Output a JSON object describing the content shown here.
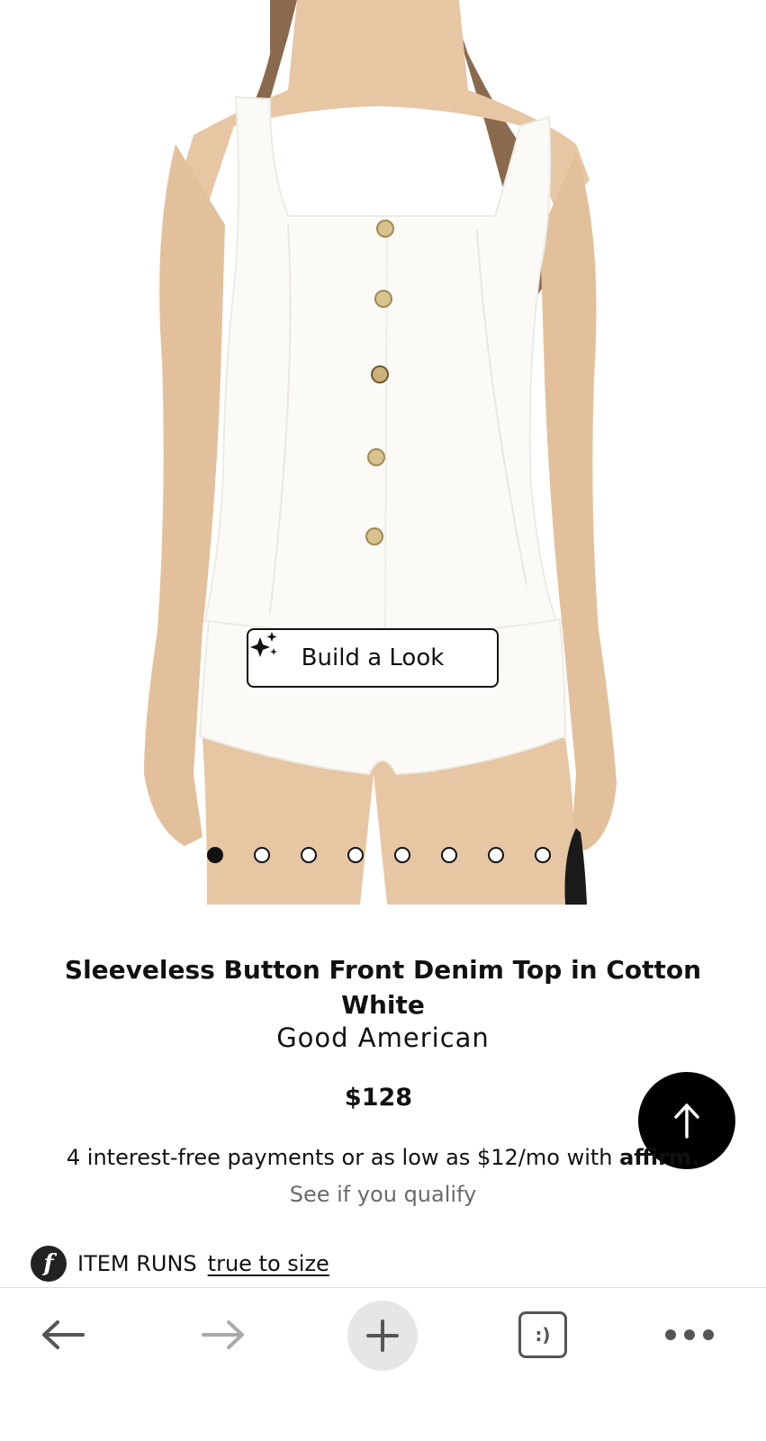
{
  "product": {
    "build_look_label": "Build a Look",
    "image_count": 8,
    "active_image_index": 0,
    "title": "Sleeveless Button Front Denim Top in Cotton White",
    "brand": "Good American",
    "price": "$128",
    "payments_text": "4 interest-free payments or as low as $12/mo with",
    "payments_provider": "affirm.",
    "qualify_link": "See if you qualify",
    "fit_label": "ITEM RUNS",
    "fit_value": "true to size",
    "fit_logo_letter": "f"
  },
  "toolbar": {
    "tabs_label": ":)"
  },
  "icons": {
    "scroll_top": "arrow-up-icon",
    "build_look": "sparkle-icon",
    "back": "arrow-left-icon",
    "forward": "arrow-right-icon",
    "new_tab": "plus-icon",
    "tabs": "tabs-icon",
    "more": "ellipsis-icon"
  },
  "colors": {
    "text": "#111111",
    "muted": "#6a6a6a",
    "accent": "#000000",
    "toolbar_inactive": "#aaaaaa"
  }
}
